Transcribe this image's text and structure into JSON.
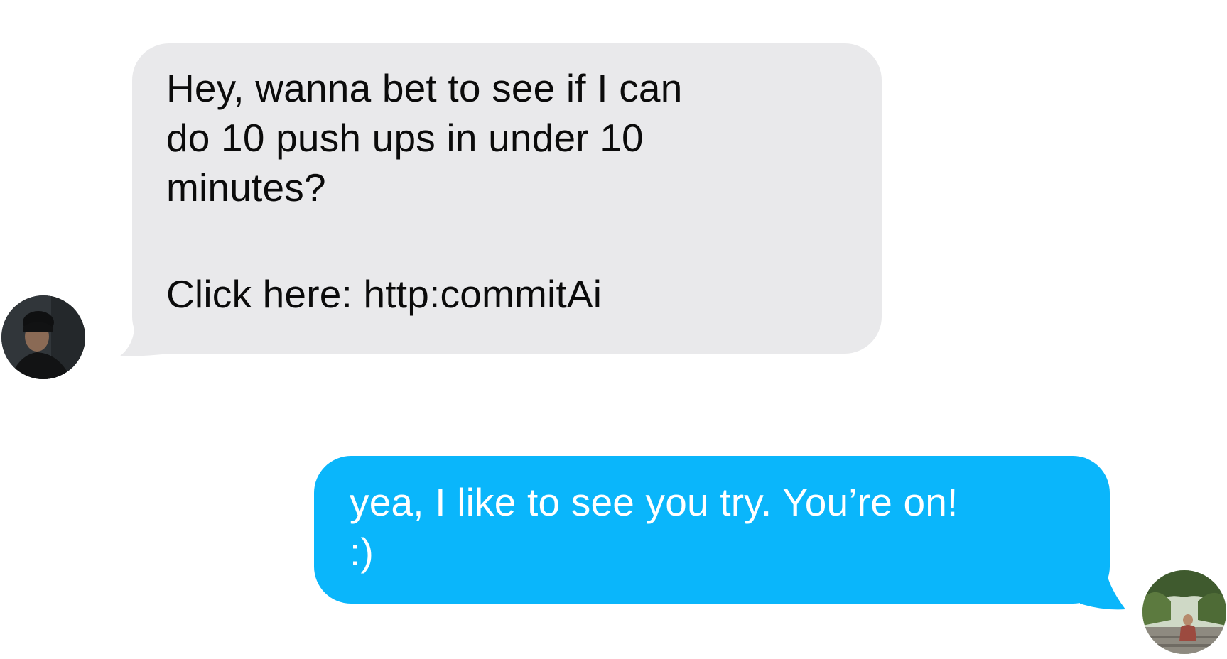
{
  "conversation": {
    "incoming": {
      "lines": [
        "Hey, wanna bet to see if I can",
        "do 10 push ups in under 10",
        "minutes?",
        "Click here: http:commitAi"
      ],
      "bubble_color": "#e9e9eb",
      "text_color": "#0b0b0b"
    },
    "outgoing": {
      "lines": [
        "yea, I like to see you try. You’re on!",
        ":)"
      ],
      "bubble_color": "#0ab6fb",
      "text_color": "#ffffff"
    }
  },
  "avatars": {
    "sender": {
      "icon": "person-portrait-icon"
    },
    "me": {
      "icon": "person-portrait-icon"
    }
  }
}
